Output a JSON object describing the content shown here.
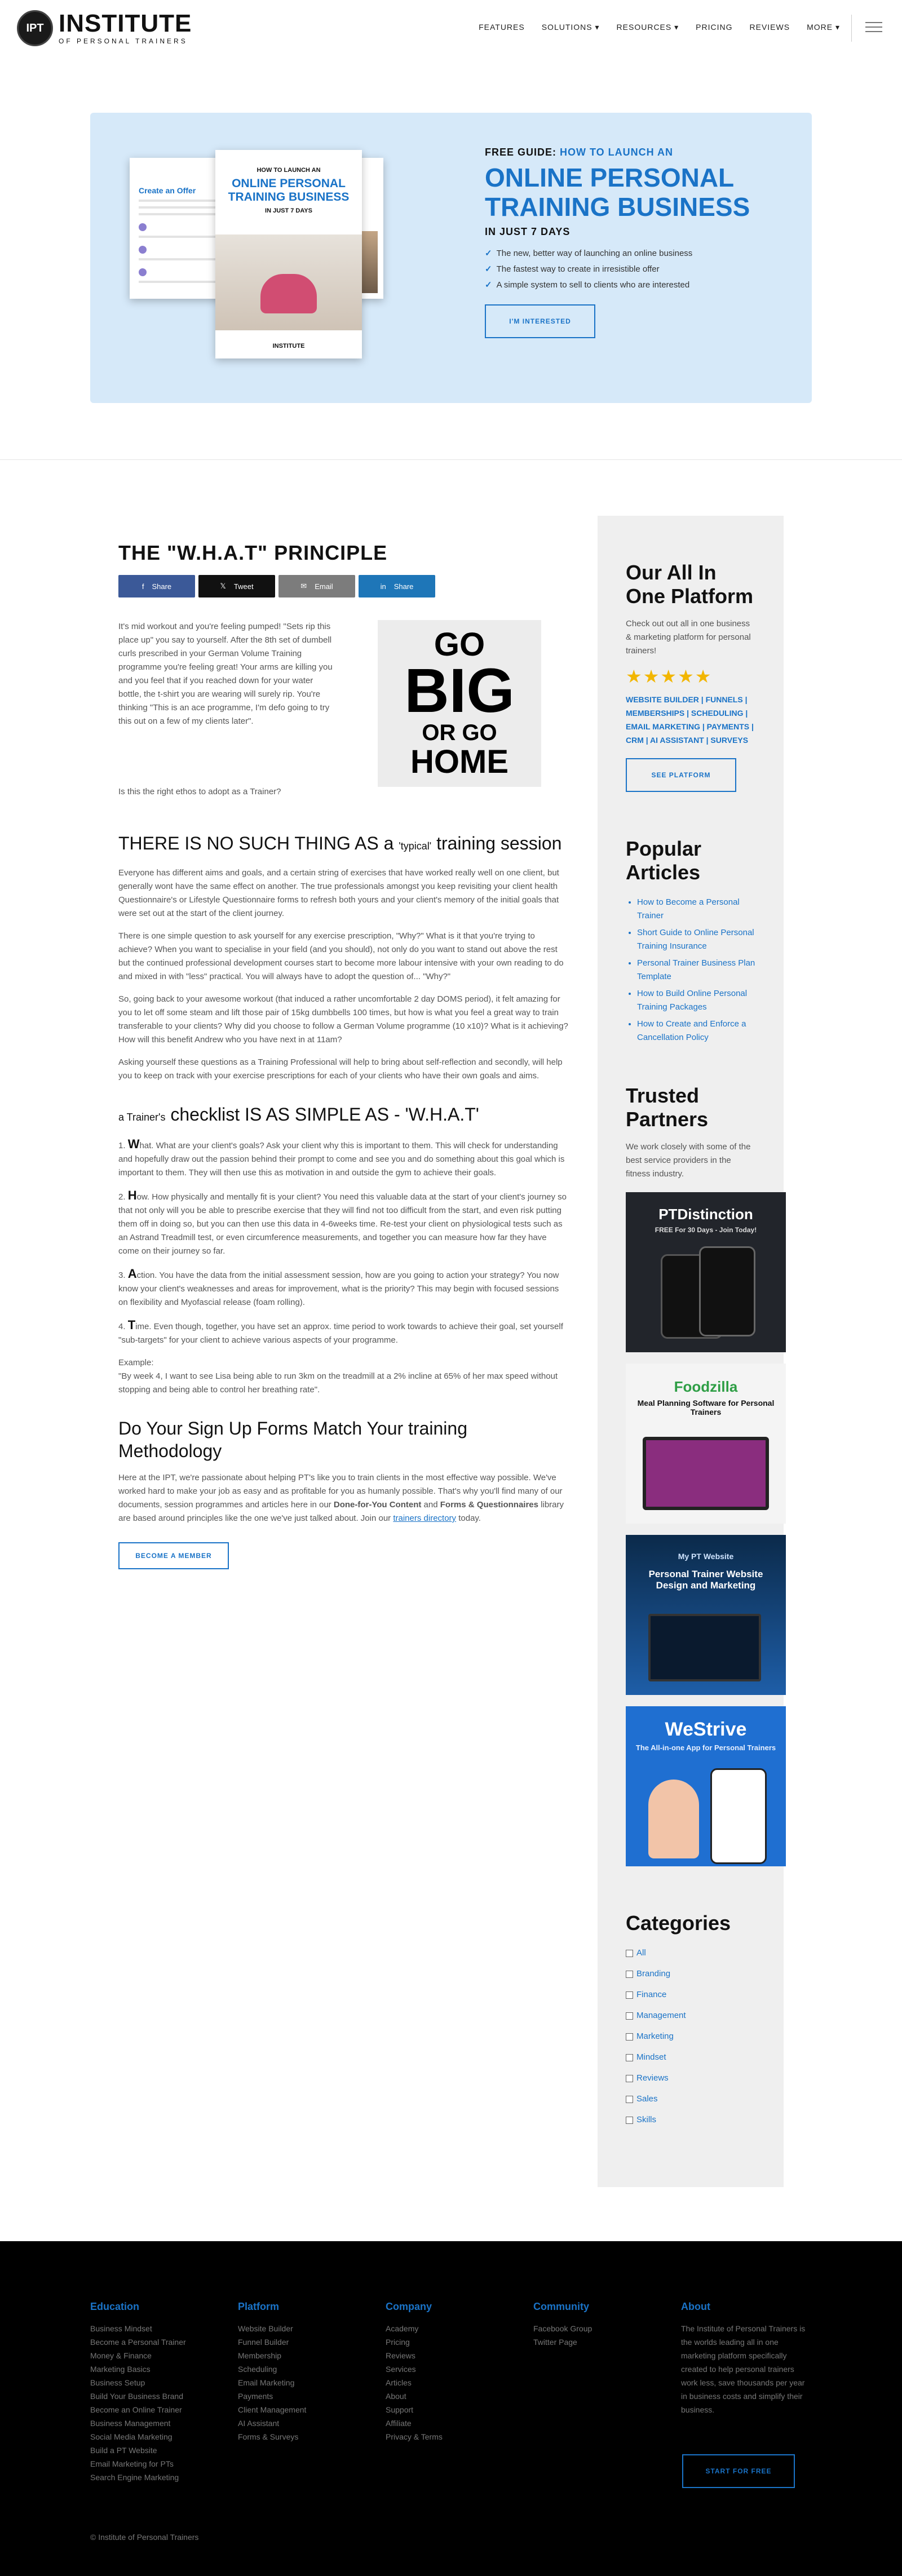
{
  "header": {
    "logo_badge": "IPT",
    "logo_title": "INSTITUTE",
    "logo_sub": "OF PERSONAL TRAINERS",
    "nav": [
      "FEATURES",
      "SOLUTIONS ▾",
      "RESOURCES ▾",
      "PRICING",
      "REVIEWS",
      "MORE ▾"
    ]
  },
  "hero": {
    "eyebrow_prefix": "FREE GUIDE: ",
    "eyebrow_highlight": "HOW TO LAUNCH AN",
    "title": "ONLINE PERSONAL TRAINING BUSINESS",
    "subtitle": "IN JUST 7 DAYS",
    "bullets": [
      "The new, better way of launching an online business",
      "The fastest way to create in irresistible offer",
      "A simple system to sell to clients who are interested"
    ],
    "button": "I'M INTERESTED",
    "book_top": "HOW TO LAUNCH AN",
    "book_title": "ONLINE PERSONAL TRAINING BUSINESS",
    "book_week": "IN JUST 7 DAYS",
    "book_logo": "INSTITUTE",
    "left_book_title": "Create an Offer"
  },
  "article": {
    "title": "THE \"W.H.A.T\" PRINCIPLE",
    "share": [
      "Share",
      "Tweet",
      "Email",
      "Share"
    ],
    "intro": "It's mid workout and you're feeling pumped! \"Sets rip this place up\" you say to yourself. After the 8th set of dumbell curls prescribed in your German Volume Training programme you're feeling great! Your arms are killing you and you feel that if you reached down for your water bottle, the t-shirt you are wearing will surely rip. You're thinking \"This is an ace programme, I'm defo going to try this out on a few of my clients later\".",
    "intro_q": "Is this the right ethos to adopt as a Trainer?",
    "gobig": [
      "GO",
      "BIG",
      "OR GO",
      "HOME"
    ],
    "h2_1_a": "THERE IS NO SUCH THING AS a ",
    "h2_1_small": "'typical'",
    "h2_1_b": " training session",
    "p1": "Everyone has different aims and goals, and a certain string of exercises that have worked really well on one client, but generally wont have the same effect on another. The true professionals amongst you keep revisiting your client health Questionnaire's or Lifestyle Questionnaire forms to refresh both yours and your client's memory of the initial goals that were set out at the start of the client journey.",
    "p2": "There is one simple question to ask yourself for any exercise prescription, \"Why?\" What is it that you're trying to achieve? When you want to specialise in your field (and you should), not only do you want to stand out above the rest but the continued professional development courses start to become more labour intensive with your own reading to do and mixed in with \"less\" practical. You will always have to adopt the question of... \"Why?\"",
    "p3": "So, going back to your awesome workout (that induced a rather uncomfortable 2 day DOMS period), it felt amazing for you to let off some steam and lift those pair of 15kg dumbbells 100 times, but how is what you feel a great way to train transferable to your clients? Why did you choose to follow a German Volume programme (10 x10)? What is it achieving? How will this benefit Andrew who you have next in at 11am?",
    "p4": "Asking yourself these questions as a Training Professional will help to bring about self-reflection and secondly, will help you to keep on track with your exercise prescriptions for each of your clients who have their own goals and aims.",
    "h2_2_a": "a Trainer's",
    "h2_2_b": " checklist IS AS SIMPLE AS - 'W.H.A.T'",
    "w_num": "1. ",
    "w_letter": "W",
    "w_text": "hat. What are your client's goals? Ask your client why this is important to them. This will check for understanding and hopefully draw out the passion behind their prompt to come and see you and do something about this goal which is important to them. They will then use this as motivation in and outside the gym to achieve their goals.",
    "h_num": "2. ",
    "h_letter": "H",
    "h_text": "ow. How physically and mentally fit is your client? You need this valuable data at the start of your client's journey so that not only will you be able to prescribe exercise that they will find not too difficult from the start, and even risk putting them off in doing so, but you can then use this data in 4-6weeks time. Re-test your client on physiological tests such as an Astrand Treadmill test, or even circumference measurements, and together you can measure how far they have come on their journey so far.",
    "a_num": "3. ",
    "a_letter": "A",
    "a_text": "ction. You have the data from the initial assessment session, how are you going to action your strategy? You now know your client's weaknesses and areas for improvement, what is the priority? This may begin with focused sessions on flexibility and Myofascial release (foam rolling).",
    "t_num": "4. ",
    "t_letter": "T",
    "t_text": "ime. Even though, together, you have set an approx. time period to work towards to achieve their goal, set yourself \"sub-targets\" for your client to achieve various aspects of your programme.",
    "example_label": "Example:",
    "example_text": "\"By week 4, I want to see Lisa being able to run 3km on the treadmill at a 2% incline at 65% of her max speed without stopping and being able to control her breathing rate\".",
    "h2_3": "Do Your Sign Up Forms Match Your training Methodology",
    "p5_a": "Here at the IPT, we're passionate about helping PT's like you to train clients in the most effective way possible. We've worked hard to make your job as easy and as profitable for you as humanly possible. That's why you'll find many of our documents, session programmes and articles here in our ",
    "p5_b1": "Done-for-You Content",
    "p5_c": " and ",
    "p5_b2": "Forms & Questionnaires",
    "p5_d": " library are based around principles like the one we've just talked about. Join our ",
    "p5_link": "trainers directory",
    "p5_e": " today.",
    "button": "BECOME A MEMBER"
  },
  "sidebar": {
    "platform_title": "Our All In One Platform",
    "platform_text": "Check out out all in one business & marketing platform for personal trainers!",
    "stars": "★★★★★",
    "platform_links": "WEBSITE BUILDER | FUNNELS | MEMBERSHIPS | SCHEDULING | EMAIL MARKETING | PAYMENTS | CRM | AI ASSISTANT | SURVEYS",
    "platform_button": "SEE PLATFORM",
    "popular_title": "Popular Articles",
    "popular": [
      "How to Become a Personal Trainer",
      "Short Guide to Online Personal Training Insurance",
      "Personal Trainer Business Plan Template",
      "How to Build Online Personal Training Packages",
      "How to Create and Enforce a Cancellation Policy"
    ],
    "partners_title": "Trusted Partners",
    "partners_text": "We work closely with some of the best service providers in the fitness industry.",
    "partner1_title": "PTDistinction",
    "partner1_sub": "FREE For 30 Days - Join Today!",
    "partner2_title": "Foodzilla",
    "partner2_sub": "Meal Planning Software for Personal Trainers",
    "partner3_brand": "My PT Website",
    "partner3_title": "Personal Trainer Website Design and Marketing",
    "partner4_title": "WeStrive",
    "partner4_sub": "The All-in-one App for Personal Trainers",
    "categories_title": "Categories",
    "categories": [
      "All",
      "Branding",
      "Finance",
      "Management",
      "Marketing",
      "Mindset",
      "Reviews",
      "Sales",
      "Skills"
    ]
  },
  "footer": {
    "education_title": "Education",
    "education": [
      "Business Mindset",
      "Become a Personal Trainer",
      "Money & Finance",
      "Marketing Basics",
      "Business Setup",
      "Build Your Business Brand",
      "Become an Online Trainer",
      "Business Management",
      "Social Media Marketing",
      "Build a PT Website",
      "Email Marketing for PTs",
      "Search Engine Marketing"
    ],
    "platform_title": "Platform",
    "platform": [
      "Website Builder",
      "Funnel Builder",
      "Membership",
      "Scheduling",
      "Email Marketing",
      "Payments",
      "Client Management",
      "AI Assistant",
      "Forms & Surveys"
    ],
    "company_title": "Company",
    "company": [
      "Academy",
      "Pricing",
      "Reviews",
      "Services",
      "Articles",
      "About",
      "Support",
      "Affiliate",
      "Privacy & Terms"
    ],
    "community_title": "Community",
    "community": [
      "Facebook Group",
      "Twitter Page"
    ],
    "about_title": "About",
    "about_text": "The Institute of Personal Trainers is the worlds leading all in one marketing platform specifically created to help personal trainers work less, save thousands per year in business costs and simplify their business.",
    "button": "START FOR FREE",
    "copyright": "© Institute of Personal Trainers"
  },
  "colors": {
    "brand_blue": "#1a73c7",
    "hero_bg": "#d6e9f9",
    "sidebar_bg": "#efefef",
    "star": "#f2b600",
    "footer_bg": "#000000"
  }
}
